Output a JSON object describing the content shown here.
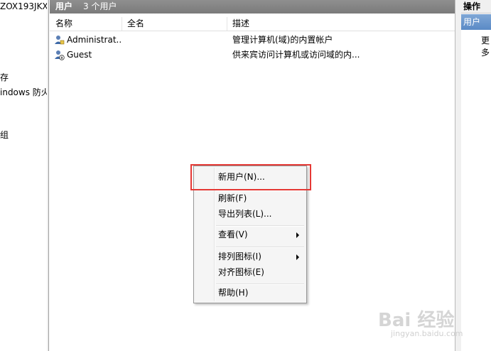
{
  "left_tree": {
    "computer_name": "ZOX193JKX",
    "item_a": "存",
    "item_b": "indows 防火",
    "item_c": "组"
  },
  "center": {
    "header_title": "用户",
    "header_count": "3 个用户",
    "columns": [
      "名称",
      "全名",
      "描述"
    ],
    "rows": [
      {
        "name": "Administrat...",
        "fullname": "",
        "description": "管理计算机(域)的内置帐户"
      },
      {
        "name": "Guest",
        "fullname": "",
        "description": "供来宾访问计算机或访问域的内..."
      }
    ]
  },
  "actions_pane": {
    "title": "操作",
    "selected": "用户",
    "more": "更多"
  },
  "context_menu": {
    "new_user": "新用户(N)...",
    "refresh": "刷新(F)",
    "export_list": "导出列表(L)...",
    "view": "查看(V)",
    "arrange_icons": "排列图标(I)",
    "line_up_icons": "对齐图标(E)",
    "help": "帮助(H)"
  },
  "watermark": {
    "brand": "Bai 经验",
    "url": "jingyan.baidu.com"
  }
}
